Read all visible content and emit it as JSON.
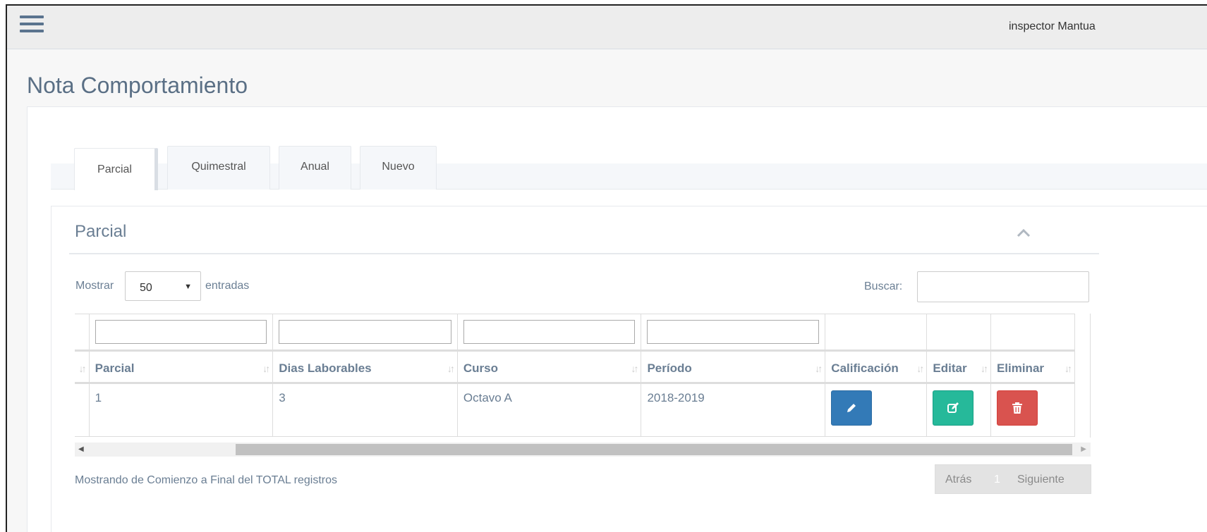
{
  "header": {
    "user_name": "inspector Mantua"
  },
  "page": {
    "title": "Nota Comportamiento"
  },
  "tabs": [
    {
      "label": "Parcial",
      "active": true
    },
    {
      "label": "Quimestral",
      "active": false
    },
    {
      "label": "Anual",
      "active": false
    },
    {
      "label": "Nuevo",
      "active": false
    }
  ],
  "panel": {
    "title": "Parcial"
  },
  "length_menu": {
    "prefix": "Mostrar",
    "value": "50",
    "suffix": "entradas"
  },
  "search": {
    "label": "Buscar:",
    "value": ""
  },
  "table": {
    "columns": [
      "Parcial",
      "Dias Laborables",
      "Curso",
      "Período",
      "Calificación",
      "Editar",
      "Eliminar"
    ],
    "rows": [
      {
        "parcial": "1",
        "dias": "3",
        "curso": "Octavo A",
        "periodo": "2018-2019"
      }
    ]
  },
  "footer": {
    "info": "Mostrando de Comienzo a Final del TOTAL registros",
    "prev": "Atrás",
    "page": "1",
    "next": "Siguiente"
  },
  "colors": {
    "calificacion_button": "#337ab7",
    "editar_button": "#26b99a",
    "eliminar_button": "#d9534f"
  },
  "icons": {
    "menu": "hamburger-icon",
    "collapse": "chevron-up-icon",
    "calificacion": "pencil-icon",
    "editar": "edit-square-icon",
    "eliminar": "trash-icon"
  }
}
